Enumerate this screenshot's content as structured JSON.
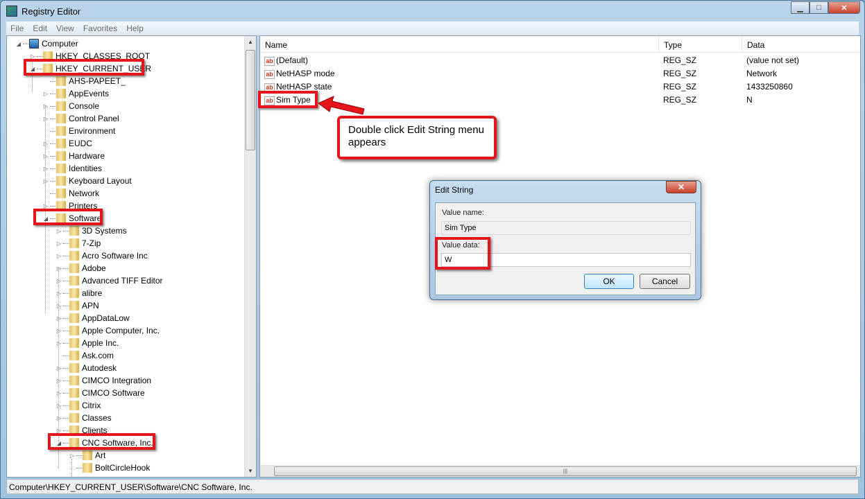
{
  "window": {
    "title": "Registry Editor",
    "close": "✕",
    "min": "▁",
    "max": "□"
  },
  "menu": [
    "File",
    "Edit",
    "View",
    "Favorites",
    "Help"
  ],
  "tree": [
    {
      "label": "Computer",
      "level": 0,
      "state": "open",
      "icon": "computer"
    },
    {
      "label": "HKEY_CLASSES_ROOT",
      "level": 1,
      "state": "closed"
    },
    {
      "label": "HKEY_CURRENT_USER",
      "level": 1,
      "state": "open"
    },
    {
      "label": "AHS-PAPEET_",
      "level": 2,
      "state": "none"
    },
    {
      "label": "AppEvents",
      "level": 2,
      "state": "closed"
    },
    {
      "label": "Console",
      "level": 2,
      "state": "closed"
    },
    {
      "label": "Control Panel",
      "level": 2,
      "state": "closed"
    },
    {
      "label": "Environment",
      "level": 2,
      "state": "none"
    },
    {
      "label": "EUDC",
      "level": 2,
      "state": "closed"
    },
    {
      "label": "Hardware",
      "level": 2,
      "state": "closed"
    },
    {
      "label": "Identities",
      "level": 2,
      "state": "closed"
    },
    {
      "label": "Keyboard Layout",
      "level": 2,
      "state": "closed"
    },
    {
      "label": "Network",
      "level": 2,
      "state": "none"
    },
    {
      "label": "Printers",
      "level": 2,
      "state": "closed"
    },
    {
      "label": "Software",
      "level": 2,
      "state": "open"
    },
    {
      "label": "3D Systems",
      "level": 3,
      "state": "closed"
    },
    {
      "label": "7-Zip",
      "level": 3,
      "state": "closed"
    },
    {
      "label": "Acro Software Inc",
      "level": 3,
      "state": "closed"
    },
    {
      "label": "Adobe",
      "level": 3,
      "state": "closed"
    },
    {
      "label": "Advanced TIFF Editor",
      "level": 3,
      "state": "closed"
    },
    {
      "label": "alibre",
      "level": 3,
      "state": "closed"
    },
    {
      "label": "APN",
      "level": 3,
      "state": "closed"
    },
    {
      "label": "AppDataLow",
      "level": 3,
      "state": "closed"
    },
    {
      "label": "Apple Computer, Inc.",
      "level": 3,
      "state": "closed"
    },
    {
      "label": "Apple Inc.",
      "level": 3,
      "state": "closed"
    },
    {
      "label": "Ask.com",
      "level": 3,
      "state": "none"
    },
    {
      "label": "Autodesk",
      "level": 3,
      "state": "closed"
    },
    {
      "label": "CIMCO Integration",
      "level": 3,
      "state": "closed"
    },
    {
      "label": "CIMCO Software",
      "level": 3,
      "state": "closed"
    },
    {
      "label": "Citrix",
      "level": 3,
      "state": "closed"
    },
    {
      "label": "Classes",
      "level": 3,
      "state": "closed"
    },
    {
      "label": "Clients",
      "level": 3,
      "state": "closed"
    },
    {
      "label": "CNC Software, Inc.",
      "level": 3,
      "state": "open"
    },
    {
      "label": "Art",
      "level": 4,
      "state": "closed"
    },
    {
      "label": "BoltCircleHook",
      "level": 4,
      "state": "none"
    }
  ],
  "columns": [
    "Name",
    "Type",
    "Data"
  ],
  "values": [
    {
      "name": "(Default)",
      "type": "REG_SZ",
      "data": "(value not set)"
    },
    {
      "name": "NetHASP mode",
      "type": "REG_SZ",
      "data": "Network"
    },
    {
      "name": "NetHASP state",
      "type": "REG_SZ",
      "data": "1433250860"
    },
    {
      "name": "Sim Type",
      "type": "REG_SZ",
      "data": "N"
    }
  ],
  "status": "Computer\\HKEY_CURRENT_USER\\Software\\CNC Software, Inc.",
  "callout": "Double click Edit String menu appears",
  "dialog": {
    "title": "Edit String",
    "value_name_label": "Value name:",
    "value_name": "Sim Type",
    "value_data_label": "Value data:",
    "value_data": "W",
    "ok": "OK",
    "cancel": "Cancel"
  },
  "colors": {
    "highlight": "#e8141b"
  }
}
